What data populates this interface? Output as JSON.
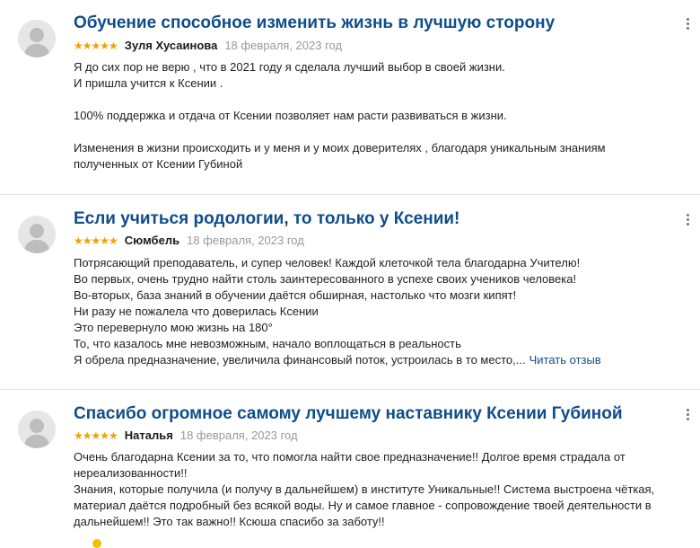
{
  "reviews": [
    {
      "title": "Обучение способное изменить жизнь в лучшую сторону",
      "stars": "★★★★★",
      "author": "Зуля Хусаинова",
      "date": "18 февраля, 2023 год",
      "paragraphs": [
        "Я до сих пор не верю , что в 2021 году я сделала лучший выбор в своей жизни.",
        "И пришла учится к Ксении .",
        "100% поддержка и отдача от Ксении позволяет нам расти развиваться в жизни.",
        "Изменения в жизни происходить и у меня и у моих доверителях , благодаря уникальным знаниям",
        "полученных от Ксении Губиной"
      ]
    },
    {
      "title": "Если учиться родологии, то только у Ксении!",
      "stars": "★★★★★",
      "author": "Сюмбель",
      "date": "18 февраля, 2023 год",
      "paragraphs": [
        "Потрясающий преподаватель, и супер человек! Каждой клеточкой тела благодарна Учителю!",
        "Во первых, очень трудно найти столь заинтересованного в успехе своих учеников человека!",
        "Во-вторых, база знаний в обучении даётся обширная, настолько что мозги кипят!",
        "Ни разу не пожалела что доверилась Ксении",
        "Это перевернуло мою жизнь на 180°",
        "То, что казалось мне невозможным, начало воплощаться в реальность",
        "Я обрела предназначение, увеличила финансовый поток, устроилась в то место,..."
      ],
      "read_more": "Читать отзыв"
    },
    {
      "title": "Спасибо огромное самому лучшему наставнику Ксении Губиной",
      "stars": "★★★★★",
      "author": "Наталья",
      "date": "18 февраля, 2023 год",
      "paragraphs": [
        "Очень благодарна Ксении за то, что помогла найти свое предназначение!! Долгое время страдала от",
        "нереализованности!!",
        "Знания, которые получила (и получу в дальнейшем) в институте Уникальные!! Система выстроена чёткая,",
        "материал даётся подробный без всякой воды. Ну и самое главное - сопровождение твоей деятельности в",
        "дальнейшем!! Это так важно!! Ксюша спасибо за заботу!!"
      ]
    }
  ],
  "colors": {
    "title": "#0f4d8a",
    "stars": "#f2a100",
    "date": "#9a9a9a",
    "divider": "#e3e3e3",
    "avatar_bg": "#e6e6e6"
  },
  "icons": {
    "avatar": "user-silhouette-icon",
    "menu": "kebab-menu-icon",
    "rating": "star-icon"
  }
}
